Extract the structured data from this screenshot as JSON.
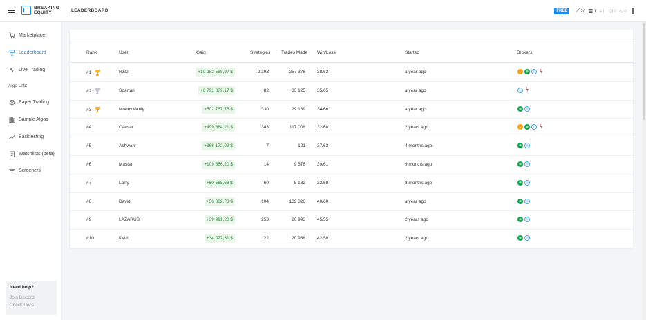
{
  "app": {
    "logo_line1": "BREAKING",
    "logo_line2": "EQUITY",
    "page_title": "LEADERBOARD"
  },
  "header": {
    "plan_badge": "FREE",
    "stats": [
      {
        "icon": "trend-icon",
        "value": "20",
        "dim": false
      },
      {
        "icon": "sliders-icon",
        "value": "1",
        "dim": false
      },
      {
        "icon": "filter-icon",
        "value": "0",
        "dim": true
      },
      {
        "icon": "database-icon",
        "value": "0",
        "dim": true
      },
      {
        "icon": "pulse-icon",
        "value": "0",
        "dim": true
      }
    ]
  },
  "sidebar": {
    "items": [
      {
        "label": "Marketplace",
        "icon": "cart-icon",
        "active": false
      },
      {
        "label": "Leaderboard",
        "icon": "trophy-icon",
        "active": true
      },
      {
        "label": "Live Trading",
        "icon": "pulse-icon",
        "active": false
      }
    ],
    "section_label": "Algo Lab:",
    "lab_items": [
      {
        "label": "Paper Trading",
        "icon": "layers-icon"
      },
      {
        "label": "Sample Algos",
        "icon": "library-icon"
      },
      {
        "label": "Backtesting",
        "icon": "trend-icon"
      },
      {
        "label": "Watchlists (beta)",
        "icon": "clipboard-icon"
      },
      {
        "label": "Screeners",
        "icon": "filter-icon"
      }
    ],
    "help": {
      "title": "Need help?",
      "link1": "Join Discord",
      "link2": "Check Docs"
    }
  },
  "table": {
    "columns": [
      "Rank",
      "User",
      "Gain",
      "Strategies",
      "Trades Made",
      "Win/Loss",
      "Started",
      "Brokers"
    ],
    "rows": [
      {
        "rank": "#1",
        "trophy": "gold",
        "user": "R&D",
        "gain": "+10 282 588,97 $",
        "strategies": "2 393",
        "trades": "257 376",
        "winloss": "38/62",
        "started": "a year ago",
        "brokers": [
          "gold",
          "green",
          "blue",
          "red"
        ]
      },
      {
        "rank": "#2",
        "trophy": "silver",
        "user": "Spartan",
        "gain": "+6 791 879,17 $",
        "strategies": "82",
        "trades": "33 125",
        "winloss": "35/65",
        "started": "a year ago",
        "brokers": [
          "blue",
          "red"
        ]
      },
      {
        "rank": "#3",
        "trophy": "bronze",
        "user": "MoneyManly",
        "gain": "+502 767,76 $",
        "strategies": "330",
        "trades": "29 189",
        "winloss": "34/66",
        "started": "a year ago",
        "brokers": [
          "green",
          "blue"
        ]
      },
      {
        "rank": "#4",
        "trophy": "",
        "user": "Caesar",
        "gain": "+499 664,21 $",
        "strategies": "343",
        "trades": "117 008",
        "winloss": "32/68",
        "started": "2 years ago",
        "brokers": [
          "gold",
          "green",
          "blue",
          "red"
        ]
      },
      {
        "rank": "#5",
        "trophy": "",
        "user": "Ashwani",
        "gain": "+366 172,03 $",
        "strategies": "7",
        "trades": "121",
        "winloss": "37/63",
        "started": "4 months ago",
        "brokers": [
          "green",
          "blue"
        ]
      },
      {
        "rank": "#6",
        "trophy": "",
        "user": "Master",
        "gain": "+109 886,20 $",
        "strategies": "14",
        "trades": "9 576",
        "winloss": "39/61",
        "started": "9 months ago",
        "brokers": [
          "green",
          "blue"
        ]
      },
      {
        "rank": "#7",
        "trophy": "",
        "user": "Larry",
        "gain": "+60 568,68 $",
        "strategies": "60",
        "trades": "5 132",
        "winloss": "32/68",
        "started": "8 months ago",
        "brokers": [
          "green",
          "blue"
        ]
      },
      {
        "rank": "#8",
        "trophy": "",
        "user": "David",
        "gain": "+56 882,73 $",
        "strategies": "104",
        "trades": "109 826",
        "winloss": "40/60",
        "started": "a year ago",
        "brokers": [
          "green",
          "blue"
        ]
      },
      {
        "rank": "#9",
        "trophy": "",
        "user": "LAZARUS",
        "gain": "+39 991,20 $",
        "strategies": "253",
        "trades": "20 993",
        "winloss": "45/55",
        "started": "2 years ago",
        "brokers": [
          "green",
          "blue"
        ]
      },
      {
        "rank": "#10",
        "trophy": "",
        "user": "Keith",
        "gain": "+34 077,31 $",
        "strategies": "22",
        "trades": "20 988",
        "winloss": "42/58",
        "started": "2 years ago",
        "brokers": [
          "green",
          "blue"
        ]
      }
    ]
  },
  "colors": {
    "accent": "#1e88e5",
    "gain_text": "#2e8b3e",
    "gain_bg": "#eaf6ea",
    "trophy_gold": "#f3b51c",
    "trophy_silver": "#c8ccd2",
    "trophy_bronze": "#f0a830"
  }
}
